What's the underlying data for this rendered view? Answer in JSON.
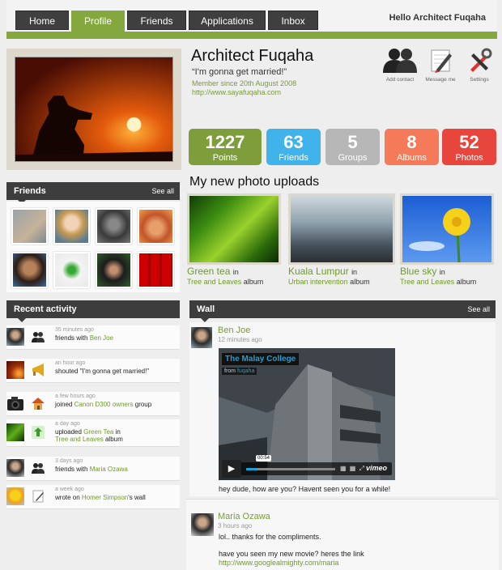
{
  "nav": {
    "tabs": [
      "Home",
      "Profile",
      "Friends",
      "Applications",
      "Inbox"
    ],
    "active": "Profile",
    "greeting": "Hello Architect Fuqaha"
  },
  "profile": {
    "name": "Architect Fuqaha",
    "quote": "“I'm gonna get married!”",
    "member_since": "Member since 20th August 2008",
    "website": "http://www.sayafuqaha.com"
  },
  "actions": [
    {
      "label": "Add contact",
      "icon": "people-icon"
    },
    {
      "label": "Message me",
      "icon": "pencil-paper-icon"
    },
    {
      "label": "Settings",
      "icon": "tools-icon"
    }
  ],
  "stats": [
    {
      "value": "1227",
      "label": "Points",
      "color": "#7e9e3c"
    },
    {
      "value": "63",
      "label": "Friends",
      "color": "#3fb3ea"
    },
    {
      "value": "5",
      "label": "Groups",
      "color": "#b7b7b7"
    },
    {
      "value": "8",
      "label": "Albums",
      "color": "#f47a5a"
    },
    {
      "value": "52",
      "label": "Photos",
      "color": "#e8453c"
    }
  ],
  "friends_section": {
    "title": "Friends",
    "see_all": "See all"
  },
  "uploads": {
    "title": "My new photo uploads",
    "items": [
      {
        "title": "Green tea",
        "in": "in",
        "album_name": "Tree and Leaves",
        "album_word": "album"
      },
      {
        "title": "Kuala Lumpur",
        "in": "in",
        "album_name": "Urban intervention",
        "album_word": "album"
      },
      {
        "title": "Blue sky",
        "in": "in",
        "album_name": "Tree and Leaves",
        "album_word": "album"
      }
    ]
  },
  "recent": {
    "title": "Recent activity",
    "items": [
      {
        "time": "35 minutes ago",
        "pre": "friends with ",
        "link": "Ben Joe",
        "post": ""
      },
      {
        "time": "an hour ago",
        "pre": "shouted \"I'm gonna get married!\"",
        "link": "",
        "post": ""
      },
      {
        "time": "a few hours ago",
        "pre": "joined ",
        "link": "Canon D300 owners",
        "post": " group"
      },
      {
        "time": "a day ago",
        "pre": "uploaded ",
        "link": "Green Tea",
        "post": " in",
        "link2": "Tree and Leaves",
        "post2": " album"
      },
      {
        "time": "3 days ago",
        "pre": "friends with ",
        "link": "Maria Ozawa",
        "post": ""
      },
      {
        "time": "a week ago",
        "pre": "wrote on ",
        "link": "Homer Simpson",
        "post": "'s wall"
      }
    ]
  },
  "wall": {
    "title": "Wall",
    "see_all": "See all",
    "posts": [
      {
        "name": "Ben Joe",
        "time": "12 minutes ago",
        "video": {
          "title": "The Malay College",
          "from": "from",
          "from_user": "fuqaha",
          "timecode": "00:54",
          "brand": "vimeo",
          "progress": 0.12
        },
        "text": "hey dude, how are you? Havent seen you for a while!"
      },
      {
        "name": "Maria Ozawa",
        "time": "3 hours ago",
        "text": "lol.. thanks for the compliments.",
        "text2": "have you seen my new movie? heres the link",
        "link": "http://www.googlealmighty.com/maria"
      }
    ]
  }
}
